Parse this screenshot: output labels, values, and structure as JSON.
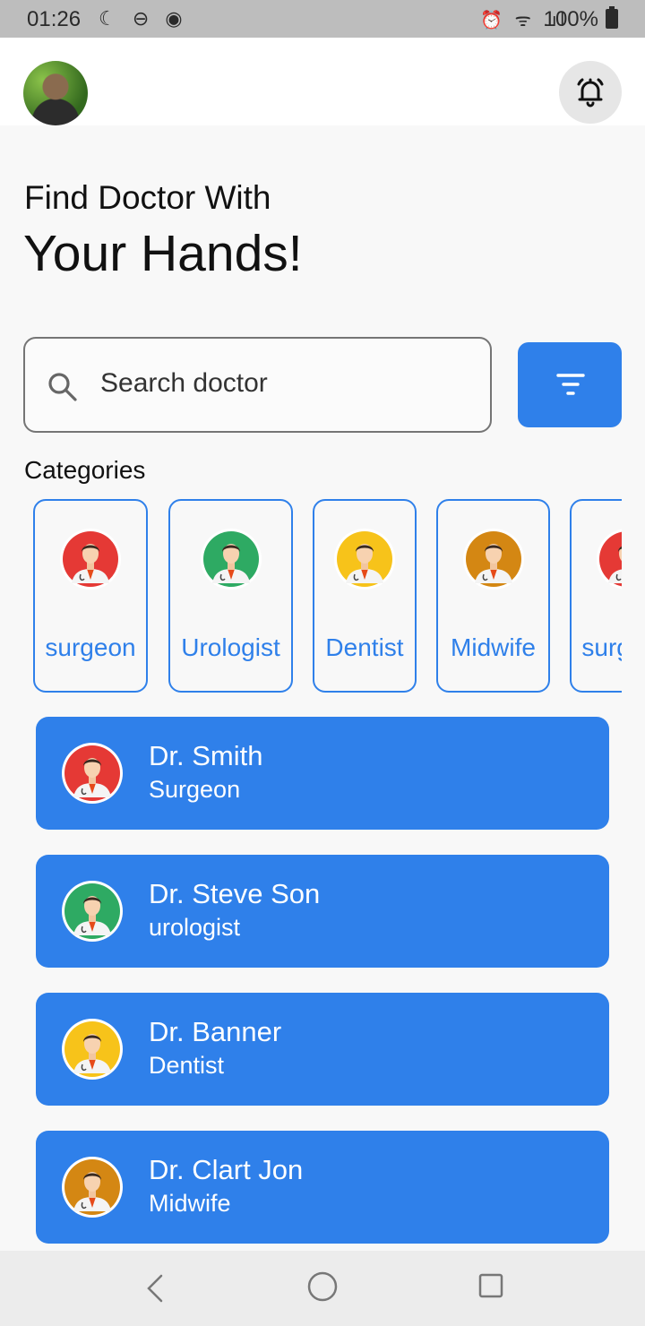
{
  "status_bar": {
    "time": "01:26",
    "left_icons": "☾ ⊖ ◉",
    "right_icons": "⏰ ᯤ .ıl",
    "battery": "100%"
  },
  "header": {
    "avatar_icon": "user-photo-avatar",
    "notification_icon": "bell-ring-icon"
  },
  "headline": {
    "line1": "Find Doctor With",
    "line2": "Your Hands!"
  },
  "search": {
    "placeholder": "Search doctor",
    "icon": "search-icon",
    "filter_icon": "filter-icon"
  },
  "categories": {
    "label": "Categories",
    "items": [
      {
        "label": "surgeon",
        "color": "#e53935"
      },
      {
        "label": "Urologist",
        "color": "#2eaa63"
      },
      {
        "label": "Dentist",
        "color": "#f7c31a"
      },
      {
        "label": "Midwife",
        "color": "#d48713"
      },
      {
        "label": "surgeon",
        "color": "#e53935"
      }
    ]
  },
  "doctors": [
    {
      "name": "Dr. Smith",
      "specialty": "Surgeon",
      "color": "#e53935"
    },
    {
      "name": "Dr. Steve Son",
      "specialty": "urologist",
      "color": "#2eaa63"
    },
    {
      "name": "Dr. Banner",
      "specialty": "Dentist",
      "color": "#f7c31a"
    },
    {
      "name": "Dr. Clart Jon",
      "specialty": "Midwife",
      "color": "#d48713"
    }
  ],
  "colors": {
    "accent": "#2f80ea",
    "background": "#f8f8f8"
  }
}
